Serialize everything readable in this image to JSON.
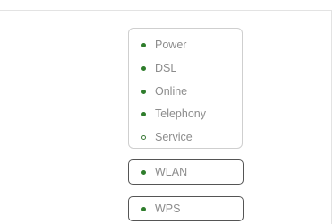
{
  "status_leds": [
    {
      "label": "Power",
      "state": "on",
      "icon": "led-indicator-icon"
    },
    {
      "label": "DSL",
      "state": "on",
      "icon": "led-indicator-icon"
    },
    {
      "label": "Online",
      "state": "on",
      "icon": "led-indicator-icon"
    },
    {
      "label": "Telephony",
      "state": "on",
      "icon": "led-indicator-icon"
    },
    {
      "label": "Service",
      "state": "off",
      "icon": "led-indicator-icon"
    }
  ],
  "buttons": {
    "wlan": {
      "label": "WLAN",
      "led_state": "on"
    },
    "wps": {
      "label": "WPS",
      "led_state": "on"
    }
  },
  "colors": {
    "led_on": "#2f7d2c",
    "label_text": "#8c8c8c",
    "panel_border": "#cfcfcf",
    "button_border": "#555555"
  }
}
